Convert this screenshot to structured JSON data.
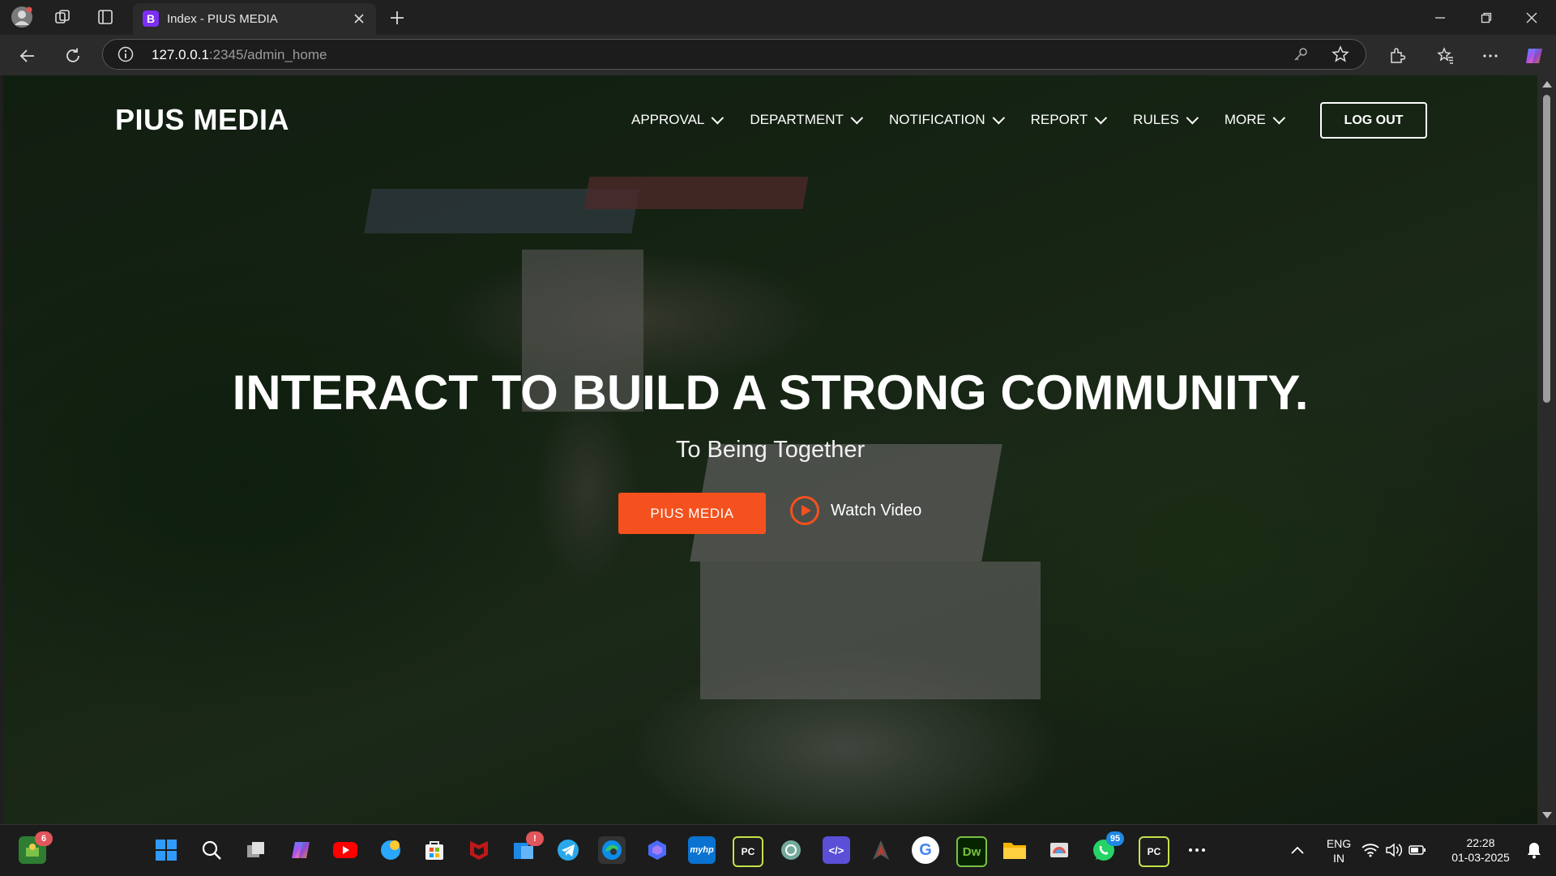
{
  "browser": {
    "tab": {
      "favicon": "B",
      "title": "Index - PIUS MEDIA"
    },
    "address": {
      "host": "127.0.0.1",
      "path": ":2345/admin_home"
    }
  },
  "site": {
    "brand": "PIUS MEDIA",
    "nav": [
      {
        "label": "APPROVAL"
      },
      {
        "label": "DEPARTMENT"
      },
      {
        "label": "NOTIFICATION"
      },
      {
        "label": "REPORT"
      },
      {
        "label": "RULES"
      },
      {
        "label": "MORE"
      }
    ],
    "logout_label": "LOG OUT",
    "hero": {
      "title": "INTERACT TO BUILD A STRONG COMMUNITY.",
      "subtitle": "To Being Together",
      "cta_label": "PIUS MEDIA",
      "watch_label": "Watch Video"
    },
    "accent_color": "#f4511e"
  },
  "taskbar": {
    "widgets_badge": "6",
    "apps": [
      {
        "name": "start",
        "label": ""
      },
      {
        "name": "search",
        "label": ""
      },
      {
        "name": "task-view",
        "label": ""
      },
      {
        "name": "copilot",
        "label": ""
      },
      {
        "name": "youtube",
        "label": ""
      },
      {
        "name": "weather",
        "label": ""
      },
      {
        "name": "store",
        "label": ""
      },
      {
        "name": "mcafee",
        "label": ""
      },
      {
        "name": "news",
        "label": ""
      },
      {
        "name": "telegram",
        "label": ""
      },
      {
        "name": "edge",
        "label": ""
      },
      {
        "name": "copilot-app",
        "label": ""
      },
      {
        "name": "myhp",
        "label": "myhp"
      },
      {
        "name": "pycharm",
        "label": "PC"
      },
      {
        "name": "chatgpt",
        "label": ""
      },
      {
        "name": "vscode",
        "label": "</>"
      },
      {
        "name": "gaming",
        "label": ""
      },
      {
        "name": "google",
        "label": "G"
      },
      {
        "name": "dreamweaver",
        "label": "Dw"
      },
      {
        "name": "file-explorer",
        "label": ""
      },
      {
        "name": "paint",
        "label": ""
      },
      {
        "name": "whatsapp",
        "label": ""
      },
      {
        "name": "pycharm-2",
        "label": "PC"
      }
    ],
    "whatsapp_badge": "95",
    "news_badge": "!",
    "lang_top": "ENG",
    "lang_bottom": "IN",
    "time": "22:28",
    "date": "01-03-2025"
  }
}
